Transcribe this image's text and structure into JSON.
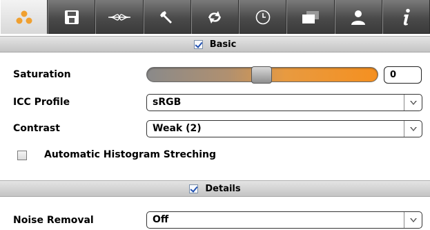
{
  "toolbar": {
    "tabs": [
      {
        "name": "exposure-tab",
        "icon": "dots-icon",
        "active": true
      },
      {
        "name": "save-tab",
        "icon": "floppy-disk-icon",
        "active": false
      },
      {
        "name": "curve-tab",
        "icon": "curve-icon",
        "active": false
      },
      {
        "name": "tools-tab",
        "icon": "wrench-icon",
        "active": false
      },
      {
        "name": "transform-tab",
        "icon": "refresh-icon",
        "active": false
      },
      {
        "name": "history-tab",
        "icon": "clock-icon",
        "active": false
      },
      {
        "name": "windows-tab",
        "icon": "windows-icon",
        "active": false
      },
      {
        "name": "user-tab",
        "icon": "person-icon",
        "active": false
      },
      {
        "name": "info-tab",
        "icon": "info-icon",
        "active": false
      }
    ]
  },
  "basic": {
    "header": "Basic",
    "checked": true,
    "saturation": {
      "label": "Saturation",
      "value": "0",
      "level": 0.5
    },
    "icc_profile": {
      "label": "ICC Profile",
      "value": "sRGB"
    },
    "contrast": {
      "label": "Contrast",
      "value": "Weak (2)"
    },
    "histogram": {
      "label": "Automatic Histogram Streching",
      "checked": false
    }
  },
  "details": {
    "header": "Details",
    "checked": true,
    "noise_removal": {
      "label": "Noise Removal",
      "value": "Off"
    }
  },
  "colors": {
    "accent_orange": "#f59020",
    "dots_orange": "#f0a030",
    "check_blue": "#2050b0"
  }
}
